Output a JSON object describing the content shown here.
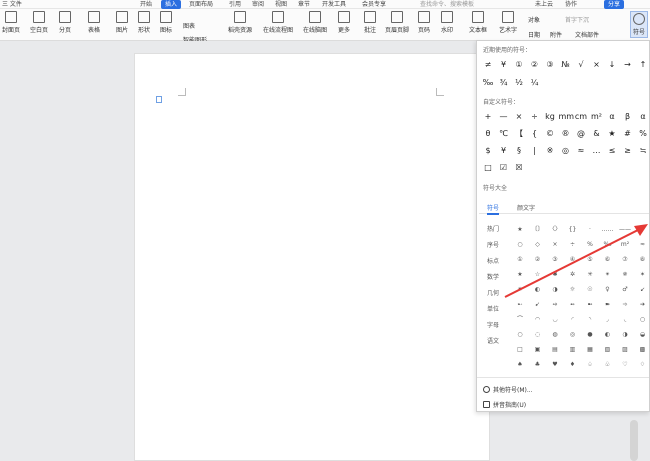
{
  "topbar": {
    "tabs": [
      "三 文件",
      "开始",
      "插入",
      "页面布局",
      "引用",
      "审阅",
      "视图",
      "章节",
      "开发工具",
      "会员专享"
    ],
    "active_tab": "插入",
    "search_placeholder": "查找命令、搜索模板",
    "right_items": [
      "未上云",
      "协作",
      "分享"
    ]
  },
  "toolbar": {
    "items": [
      "封面页",
      "空白页",
      "分页",
      "表格",
      "图片",
      "形状",
      "图标",
      "稻壳资源",
      "在线流程图",
      "在线脑图",
      "更多",
      "批注",
      "页眉页脚",
      "页码",
      "水印",
      "文本框",
      "艺术字",
      "日期",
      "附件",
      "文档部件",
      "符号"
    ],
    "smart_art": "智能图形",
    "chart": "图表",
    "object": "对象",
    "first_letter": "首字下沉"
  },
  "panel": {
    "recent_title": "近期使用的符号：",
    "recent_symbols_row1": [
      "≠",
      "¥",
      "①",
      "②",
      "③",
      "№",
      "√",
      "×",
      "↓",
      "→",
      "↑"
    ],
    "recent_symbols_row2": [
      "‰",
      "¾",
      "½",
      "¼"
    ],
    "custom_title": "自定义符号：",
    "custom_row1": [
      "+",
      "—",
      "×",
      "÷",
      "kg",
      "mm",
      "cm",
      "m²",
      "α",
      "β",
      "α"
    ],
    "custom_row2": [
      "θ",
      "℃",
      "【",
      "{",
      "©",
      "®",
      "@",
      "&",
      "★",
      "#",
      "%"
    ],
    "custom_row3": [
      "$",
      "¥",
      "§",
      "|",
      "※",
      "◎",
      "≈",
      "…",
      "≤",
      "≥",
      "≒"
    ],
    "custom_row4": [
      "□",
      "☑",
      "☒"
    ],
    "all_title": "符号大全",
    "tabs": [
      "符号",
      "颜文字"
    ],
    "categories": [
      "热门",
      "序号",
      "标点",
      "数学",
      "几何",
      "单位",
      "字母",
      "语文"
    ],
    "grid_rows": [
      [
        "★",
        "〔〕",
        "〈〉",
        "{}",
        "·",
        "……",
        "——",
        "~"
      ],
      [
        "○",
        "◇",
        "×",
        "÷",
        "%",
        "‰",
        "m²",
        "≈"
      ],
      [
        "①",
        "②",
        "③",
        "④",
        "⑤",
        "⑥",
        "⑦",
        "⑧"
      ],
      [
        "★",
        "☆",
        "✱",
        "✲",
        "✳",
        "✴",
        "✵",
        "✶"
      ],
      [
        "✷",
        "◐",
        "◑",
        "☼",
        "☉",
        "♀",
        "♂",
        "↙"
      ],
      [
        "➸",
        "➹",
        "➺",
        "➻",
        "➼",
        "➽",
        "➾",
        "➔"
      ],
      [
        "⌒",
        "◠",
        "◡",
        "◜",
        "◝",
        "◞",
        "◟",
        "○"
      ],
      [
        "○",
        "◌",
        "◍",
        "◎",
        "●",
        "◐",
        "◑",
        "◒"
      ],
      [
        "□",
        "▣",
        "▤",
        "▥",
        "▦",
        "▧",
        "▨",
        "▩"
      ],
      [
        "♠",
        "♣",
        "♥",
        "♦",
        "♤",
        "♧",
        "♡",
        "♢"
      ]
    ],
    "footer_more": "其他符号(M)...",
    "footer_pinyin": "拼音指南(U)"
  }
}
